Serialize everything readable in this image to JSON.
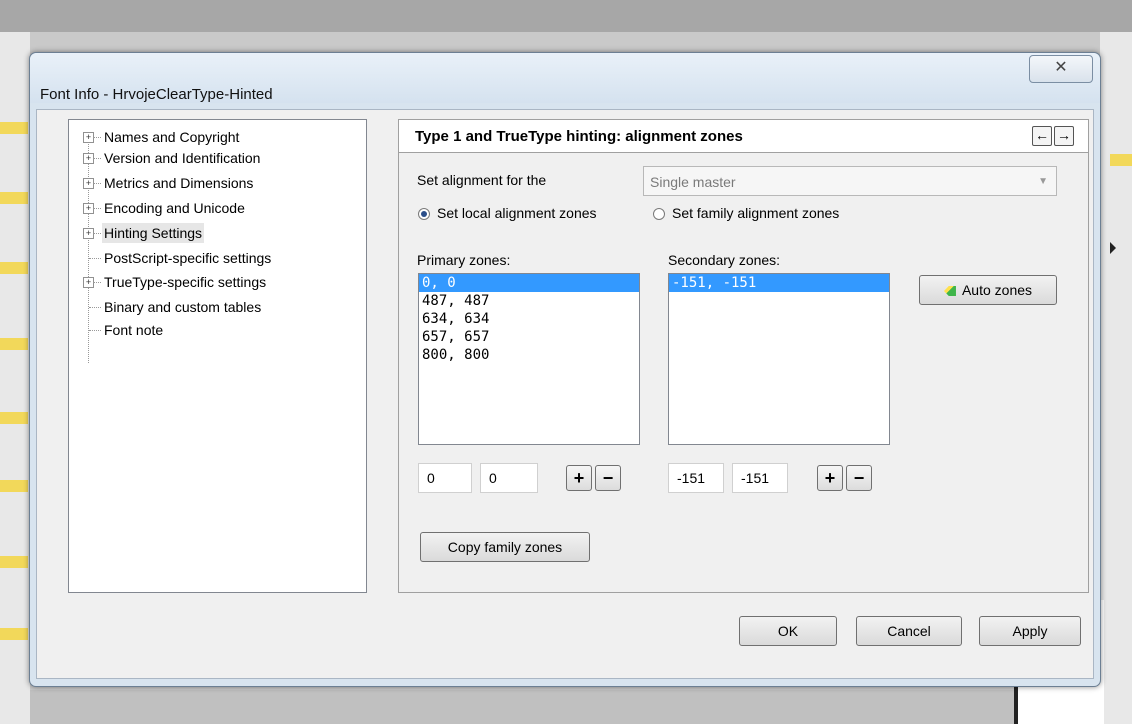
{
  "dialog": {
    "title": "Font Info - HrvojeClearType-Hinted",
    "close_symbol": "✕"
  },
  "tree": {
    "items": [
      {
        "label": "Names and Copyright",
        "expandable": true
      },
      {
        "label": "Version and Identification",
        "expandable": true
      },
      {
        "label": "Metrics and Dimensions",
        "expandable": true
      },
      {
        "label": "Encoding and Unicode",
        "expandable": true
      },
      {
        "label": "Hinting Settings",
        "expandable": true,
        "selected": true
      },
      {
        "label": "PostScript-specific settings",
        "expandable": false
      },
      {
        "label": "TrueType-specific settings",
        "expandable": true
      },
      {
        "label": "Binary and custom tables",
        "expandable": false
      },
      {
        "label": "Font note",
        "expandable": false
      }
    ],
    "expander_symbol": "+"
  },
  "panel": {
    "title": "Type 1 and TrueType hinting: alignment zones",
    "back_symbol": "←",
    "forward_symbol": "→",
    "set_alignment_label": "Set alignment for the",
    "master_select_value": "Single master",
    "radio_local_label": "Set local alignment zones",
    "radio_family_label": "Set family alignment zones",
    "radio_selected": "local",
    "primary_label": "Primary zones:",
    "secondary_label": "Secondary zones:",
    "primary_zones": [
      "0, 0",
      "487, 487",
      "634, 634",
      "657, 657",
      "800, 800"
    ],
    "secondary_zones": [
      "-151, -151"
    ],
    "primary_input_1": "0",
    "primary_input_2": "0",
    "secondary_input_1": "-151",
    "secondary_input_2": "-151",
    "plus_symbol": "+",
    "minus_symbol": "−",
    "auto_zones_label": "Auto zones",
    "copy_family_label": "Copy family zones"
  },
  "buttons": {
    "ok": "OK",
    "cancel": "Cancel",
    "apply": "Apply"
  },
  "colors": {
    "selection": "#3399ff",
    "dialog_frame": "#d8e4ef"
  }
}
